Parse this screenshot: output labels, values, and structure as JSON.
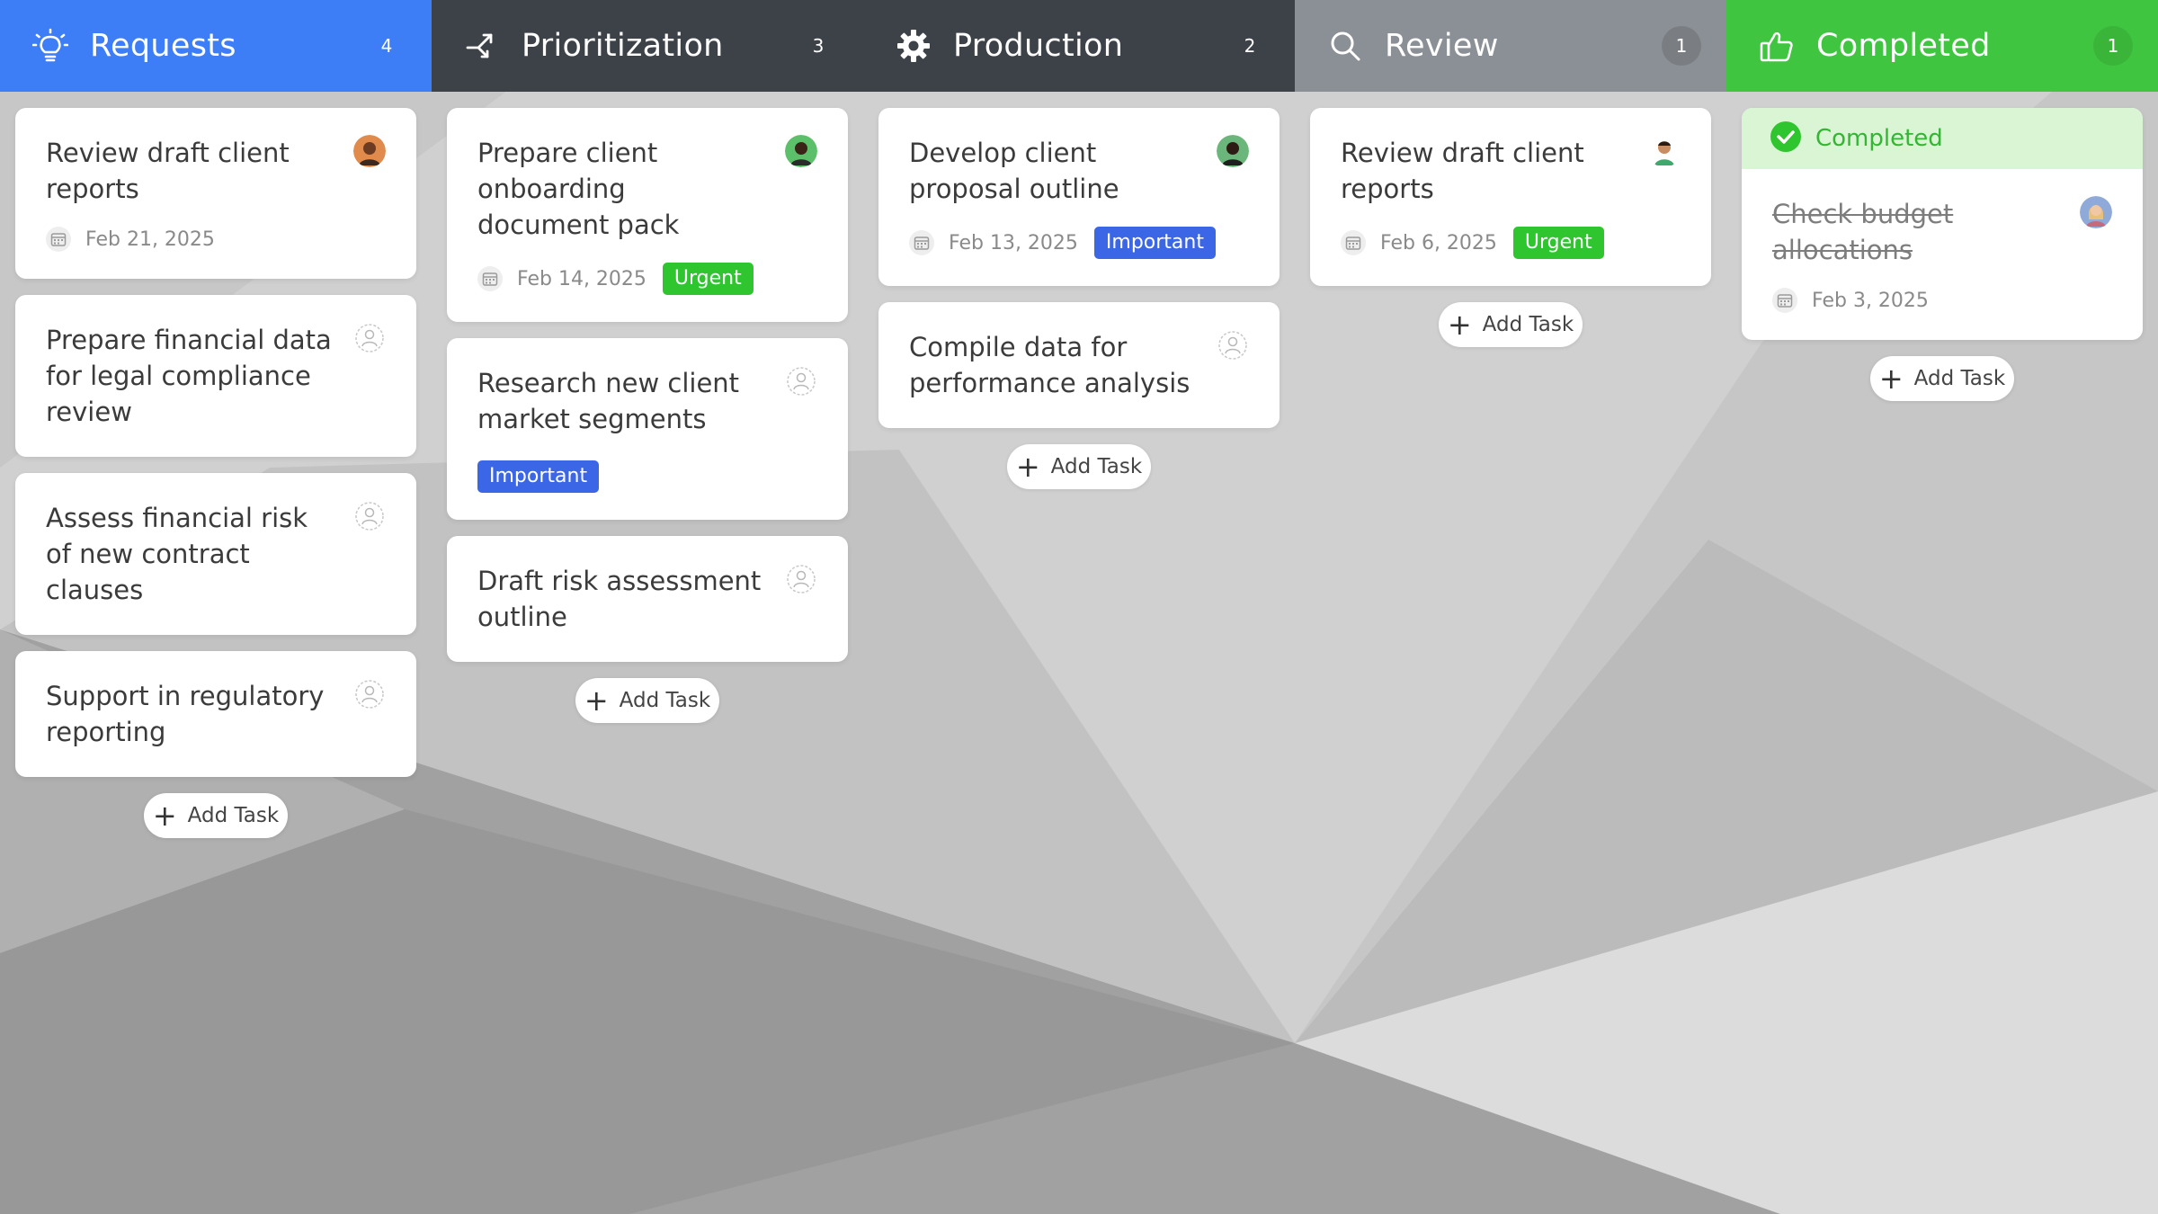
{
  "colors": {
    "requests_header": "#3d7df5",
    "prioritization_header": "#3d4148",
    "production_header": "#3d4148",
    "review_header": "#8b9096",
    "completed_header": "#3fc53f",
    "urgent": "#2ec52e",
    "important": "#3b66e6"
  },
  "add_task_label": "Add Task",
  "columns": [
    {
      "title": "Requests",
      "count": "4",
      "icon": "lightbulb-icon",
      "cards": [
        {
          "title": "Review draft client reports",
          "date": "Feb 21, 2025",
          "tag": "",
          "avatar": "person-avatar"
        },
        {
          "title": "Prepare financial data for legal compliance review",
          "date": "",
          "tag": "",
          "avatar": "unassigned-user-icon"
        },
        {
          "title": "Assess financial risk of new contract clauses",
          "date": "",
          "tag": "",
          "avatar": "unassigned-user-icon"
        },
        {
          "title": "Support in regulatory reporting",
          "date": "",
          "tag": "",
          "avatar": "unassigned-user-icon"
        }
      ]
    },
    {
      "title": "Prioritization",
      "count": "3",
      "icon": "prioritize-arrow-icon",
      "cards": [
        {
          "title": "Prepare client onboarding document pack",
          "date": "Feb 14, 2025",
          "tag": "Urgent",
          "avatar": "person-avatar"
        },
        {
          "title": "Research new client market segments",
          "date": "",
          "tag": "Important",
          "avatar": "unassigned-user-icon"
        },
        {
          "title": "Draft risk assessment outline",
          "date": "",
          "tag": "",
          "avatar": "unassigned-user-icon"
        }
      ]
    },
    {
      "title": "Production",
      "count": "2",
      "icon": "gear-icon",
      "cards": [
        {
          "title": "Develop client proposal outline",
          "date": "Feb 13, 2025",
          "tag": "Important",
          "avatar": "person-avatar"
        },
        {
          "title": "Compile data for performance analysis",
          "date": "",
          "tag": "",
          "avatar": "unassigned-user-icon"
        }
      ]
    },
    {
      "title": "Review",
      "count": "1",
      "icon": "search-icon",
      "cards": [
        {
          "title": "Review draft client reports",
          "date": "Feb 6, 2025",
          "tag": "Urgent",
          "avatar": "person-avatar"
        }
      ]
    },
    {
      "title": "Completed",
      "count": "1",
      "icon": "thumbs-up-icon",
      "banner": "Completed",
      "cards": [
        {
          "title": "Check budget allocations",
          "date": "Feb 3, 2025",
          "tag": "",
          "avatar": "person-avatar",
          "done": true
        }
      ]
    }
  ]
}
